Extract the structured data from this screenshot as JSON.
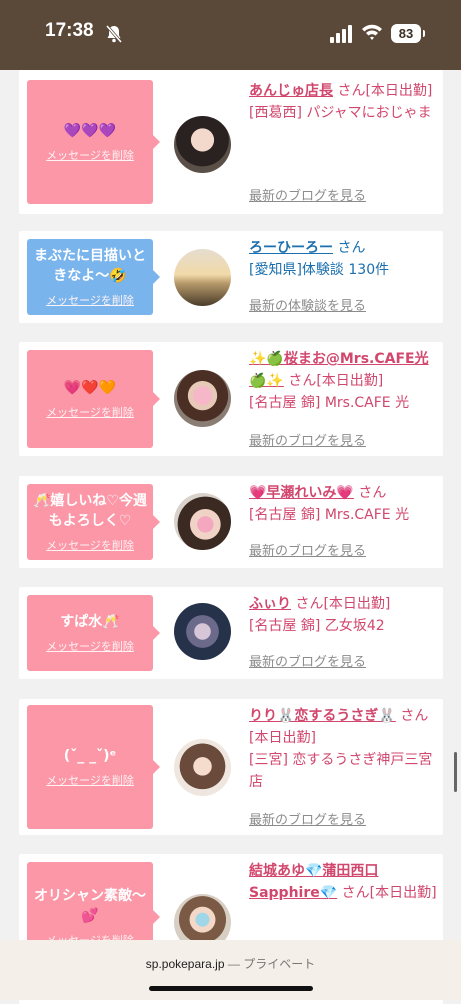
{
  "status": {
    "time": "17:38",
    "battery": "83"
  },
  "browser": {
    "domain": "sp.pokepara.jp",
    "private_label": "— プライベート"
  },
  "cards": [
    {
      "bubble_msg": "💜💜💜",
      "delete_label": "メッセージを削除",
      "name": "あんじゅ店長",
      "san": "さん",
      "tag": "[本日出勤]",
      "detail": "[西葛西] パジャマにおじゃま",
      "link": "最新のブログを見る"
    },
    {
      "bubble_msg": "まぶたに目描いときなよ〜🤣",
      "delete_label": "メッセージを削除",
      "name": "ろーひーろー",
      "san": "さん",
      "tag": "",
      "detail": "[愛知県]体験談 130件",
      "link": "最新の体験談を見る"
    },
    {
      "bubble_msg": "💗❤️🧡",
      "delete_label": "メッセージを削除",
      "name": "✨🍏桜まお@Mrs.CAFE光🍏✨",
      "san": "さん",
      "tag": "[本日出勤]",
      "detail": "[名古屋 錦] Mrs.CAFE 光",
      "link": "最新のブログを見る"
    },
    {
      "bubble_msg": "🥂嬉しいね♡今週もよろしく♡",
      "delete_label": "メッセージを削除",
      "name": "💗早瀬れいみ💗",
      "san": "さん",
      "tag": "",
      "detail": "[名古屋 錦] Mrs.CAFE 光",
      "link": "最新のブログを見る"
    },
    {
      "bubble_msg": "すぱ水🥂",
      "delete_label": "メッセージを削除",
      "name": "ふぃり",
      "san": "さん",
      "tag": "[本日出勤]",
      "detail": "[名古屋 錦] 乙女坂42",
      "link": "最新のブログを見る"
    },
    {
      "bubble_msg": "(ˇ_ _ˇ)ᵉ",
      "delete_label": "メッセージを削除",
      "name": "りり🐰恋するうさぎ🐰",
      "san": "さん",
      "tag": "[本日出勤]",
      "detail": "[三宮] 恋するうさぎ神戸三宮店",
      "link": "最新のブログを見る"
    },
    {
      "bubble_msg": "オリシャン素敵〜💕",
      "delete_label": "メッセージを削除",
      "name": "結城あゆ💎蒲田西口Sapphire💎",
      "san": "さん",
      "tag": "[本日出勤]",
      "detail": "",
      "link": ""
    }
  ]
}
